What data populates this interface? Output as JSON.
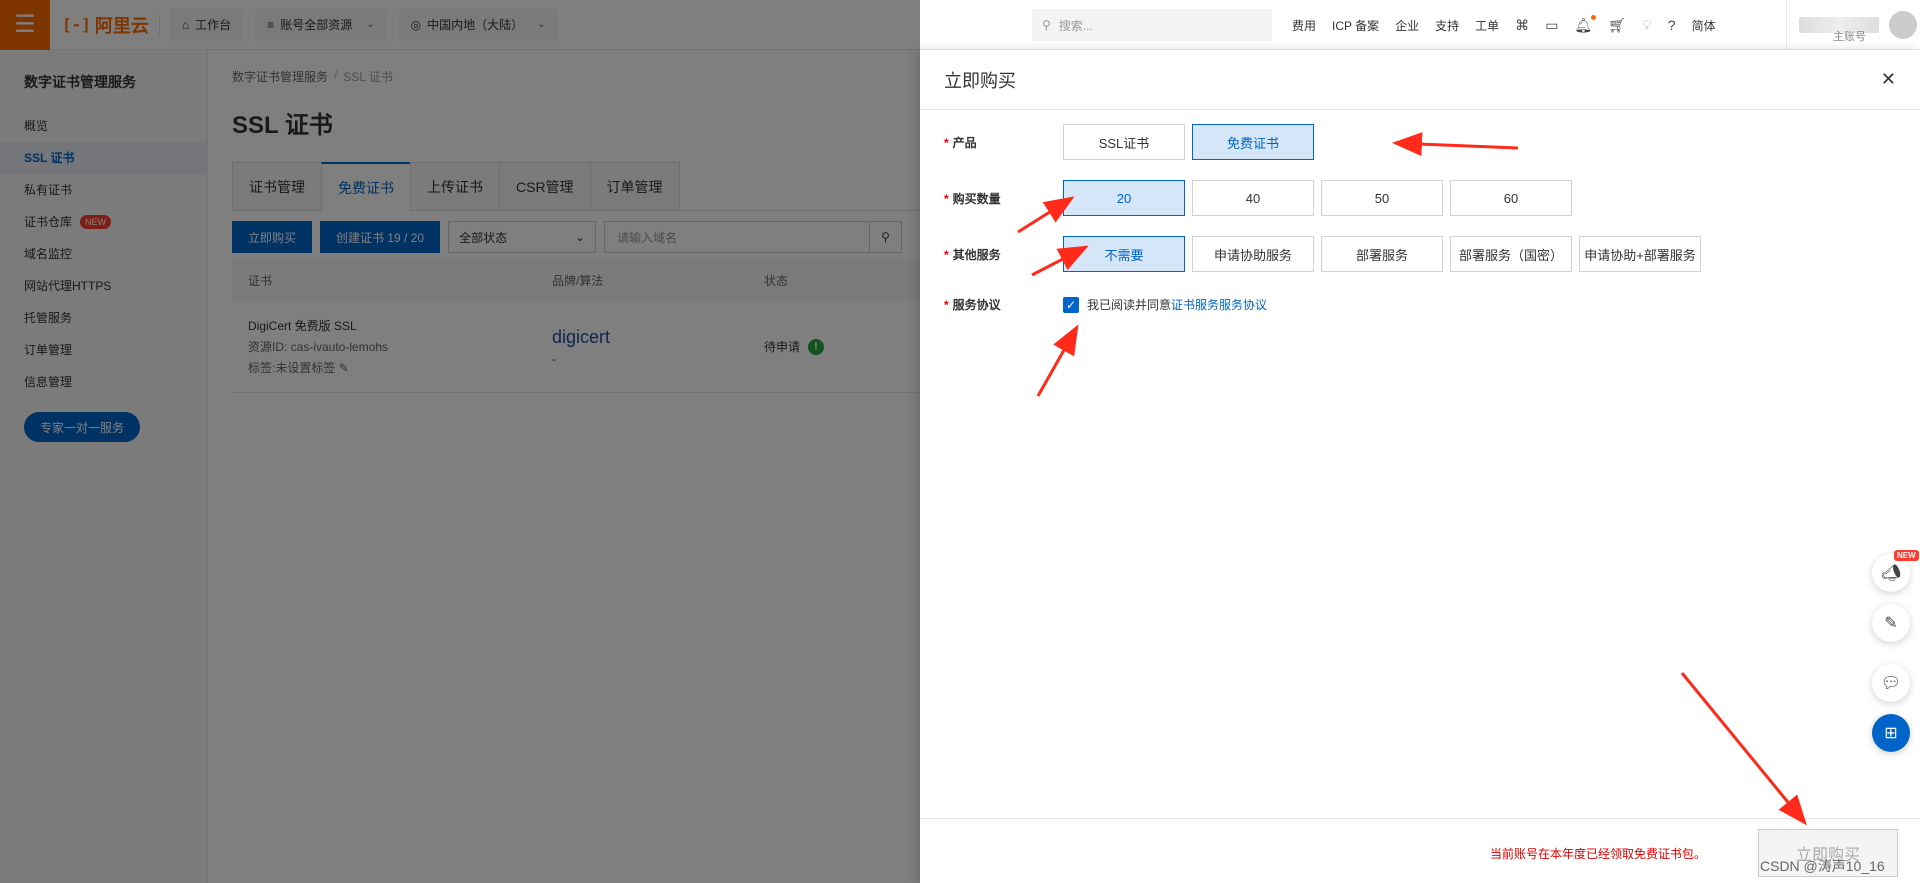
{
  "topbar": {
    "logo_text": "阿里云",
    "workbench": "工作台",
    "resources": "账号全部资源",
    "region": "中国内地（大陆）",
    "search_placeholder": "搜索...",
    "links": [
      "费用",
      "ICP 备案",
      "企业",
      "支持",
      "工单"
    ],
    "lang": "简体",
    "user_sub": "主账号"
  },
  "sidebar": {
    "title": "数字证书管理服务",
    "items": [
      {
        "label": "概览"
      },
      {
        "label": "SSL 证书",
        "active": true
      },
      {
        "label": "私有证书"
      },
      {
        "label": "证书仓库",
        "badge": "NEW"
      },
      {
        "label": "域名监控"
      },
      {
        "label": "网站代理HTTPS"
      },
      {
        "label": "托管服务"
      },
      {
        "label": "订单管理"
      },
      {
        "label": "信息管理"
      }
    ],
    "expert_button": "专家一对一服务"
  },
  "main": {
    "breadcrumb": [
      "数字证书管理服务",
      "SSL 证书"
    ],
    "title": "SSL 证书",
    "tabs": [
      "证书管理",
      "免费证书",
      "上传证书",
      "CSR管理",
      "订单管理"
    ],
    "active_tab": "免费证书",
    "buy_button": "立即购买",
    "create_button": "创建证书 19 / 20",
    "status_select": "全部状态",
    "domain_placeholder": "请输入域名",
    "table": {
      "headers": [
        "证书",
        "品牌/算法",
        "状态"
      ],
      "rows": [
        {
          "name": "DigiCert 免费版 SSL",
          "resource_id": "资源ID: cas-ivauto-lemohs",
          "tag": "标签:未设置标签",
          "brand": "digicert",
          "algo": "-",
          "status": "待申请"
        }
      ]
    }
  },
  "drawer": {
    "title": "立即购买",
    "product_label": "产品",
    "product_options": [
      "SSL证书",
      "免费证书"
    ],
    "product_selected": "免费证书",
    "qty_label": "购买数量",
    "qty_options": [
      "20",
      "40",
      "50",
      "60"
    ],
    "qty_selected": "20",
    "service_label": "其他服务",
    "service_options": [
      "不需要",
      "申请协助服务",
      "部署服务",
      "部署服务（国密）",
      "申请协助+部署服务"
    ],
    "service_selected": "不需要",
    "agreement_label": "服务协议",
    "agreement_text": "我已阅读并同意",
    "agreement_link": "证书服务服务协议",
    "agreement_checked": true,
    "footer_message": "当前账号在本年度已经领取免费证书包。",
    "footer_button": "立即购买"
  },
  "float_tools": {
    "new_badge": "NEW"
  },
  "watermark": "CSDN @涛声10_16",
  "colors": {
    "brand_orange": "#ff6a00",
    "primary_blue": "#0064c8",
    "selected_bg": "#d4e6f7",
    "arrow_red": "#ff2a1a"
  }
}
